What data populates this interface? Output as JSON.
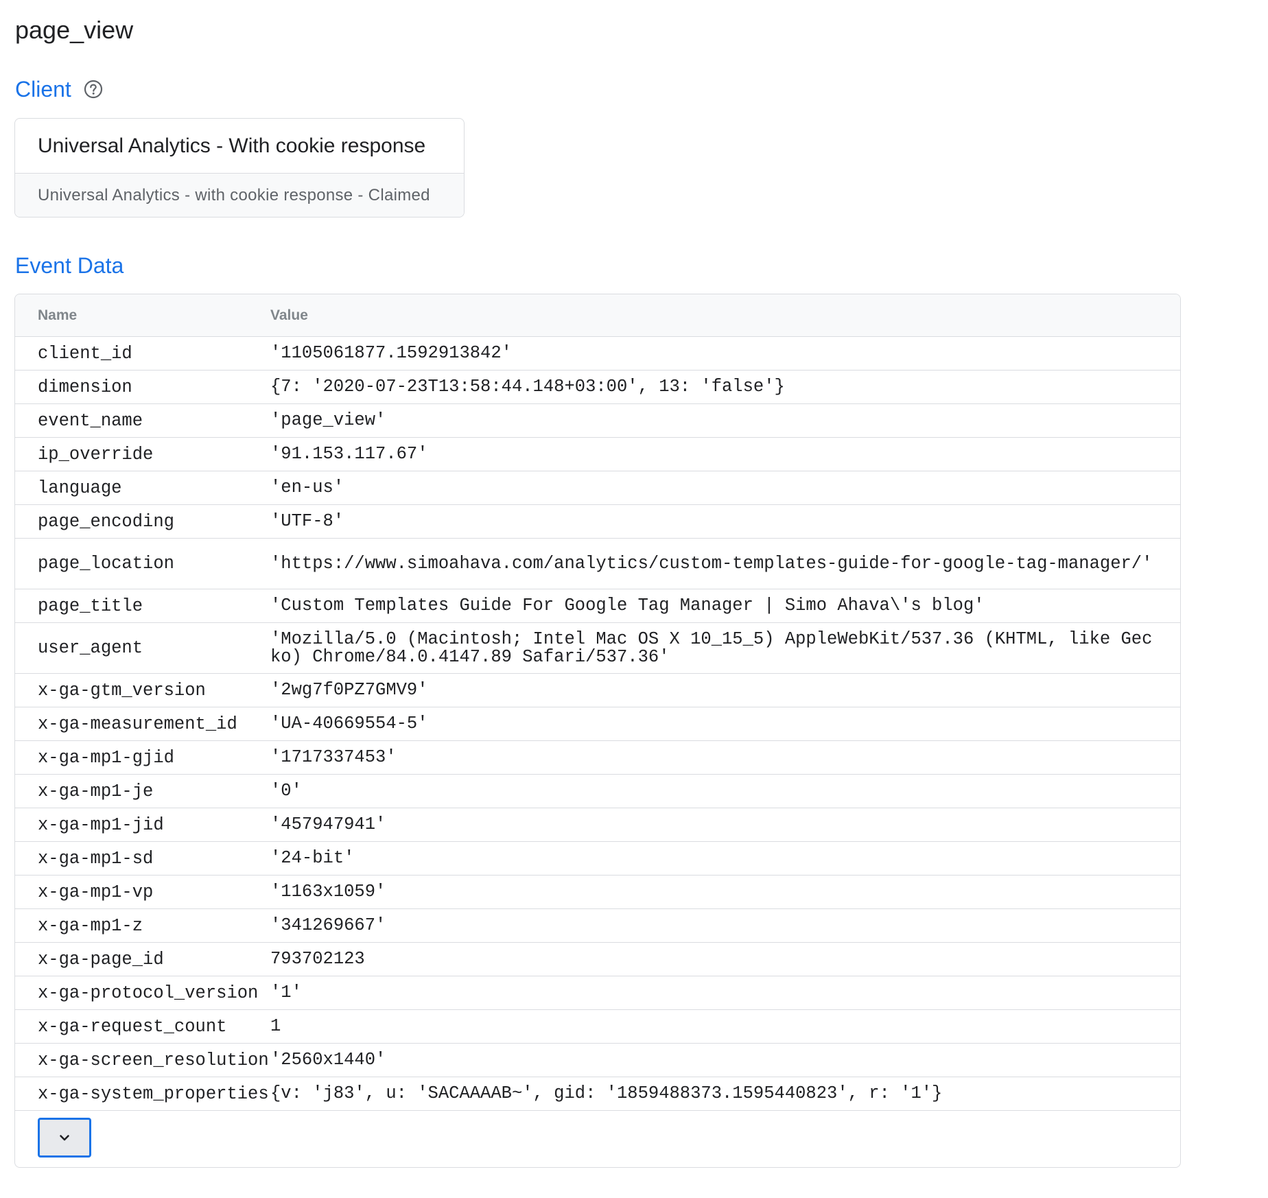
{
  "page": {
    "title": "page_view"
  },
  "client_section": {
    "heading": "Client",
    "help_icon": "help-circle-icon",
    "card_title": "Universal Analytics - With cookie response",
    "card_subtitle": "Universal Analytics - with cookie response - Claimed"
  },
  "event_data": {
    "heading": "Event Data",
    "columns": [
      "Name",
      "Value"
    ],
    "rows": [
      {
        "name": "client_id",
        "value": "'1105061877.1592913842'"
      },
      {
        "name": "dimension",
        "value": "{7: '2020-07-23T13:58:44.148+03:00', 13: 'false'}"
      },
      {
        "name": "event_name",
        "value": "'page_view'"
      },
      {
        "name": "ip_override",
        "value": "'91.153.117.67'"
      },
      {
        "name": "language",
        "value": "'en-us'"
      },
      {
        "name": "page_encoding",
        "value": "'UTF-8'"
      },
      {
        "name": "page_location",
        "value": "'https://www.simoahava.com/analytics/custom-templates-guide-for-google-tag-manager/'"
      },
      {
        "name": "page_title",
        "value": "'Custom Templates Guide For Google Tag Manager | Simo Ahava\\'s blog'"
      },
      {
        "name": "user_agent",
        "value": "'Mozilla/5.0 (Macintosh; Intel Mac OS X 10_15_5) AppleWebKit/537.36 (KHTML, like Gecko) Chrome/84.0.4147.89 Safari/537.36'"
      },
      {
        "name": "x-ga-gtm_version",
        "value": "'2wg7f0PZ7GMV9'"
      },
      {
        "name": "x-ga-measurement_id",
        "value": "'UA-40669554-5'"
      },
      {
        "name": "x-ga-mp1-gjid",
        "value": "'1717337453'"
      },
      {
        "name": "x-ga-mp1-je",
        "value": "'0'"
      },
      {
        "name": "x-ga-mp1-jid",
        "value": "'457947941'"
      },
      {
        "name": "x-ga-mp1-sd",
        "value": "'24-bit'"
      },
      {
        "name": "x-ga-mp1-vp",
        "value": "'1163x1059'"
      },
      {
        "name": "x-ga-mp1-z",
        "value": "'341269667'"
      },
      {
        "name": "x-ga-page_id",
        "value": "793702123"
      },
      {
        "name": "x-ga-protocol_version",
        "value": "'1'"
      },
      {
        "name": "x-ga-request_count",
        "value": "1"
      },
      {
        "name": "x-ga-screen_resolution",
        "value": "'2560x1440'"
      },
      {
        "name": "x-ga-system_properties",
        "value": "{v: 'j83', u: 'SACAAAAB~', gid: '1859488373.1595440823', r: '1'}"
      }
    ],
    "expand_icon": "chevron-down-icon"
  },
  "colors": {
    "accent": "#1a73e8",
    "border": "#dadce0",
    "header_bg": "#f8f9fa",
    "muted_text": "#5f6368"
  }
}
